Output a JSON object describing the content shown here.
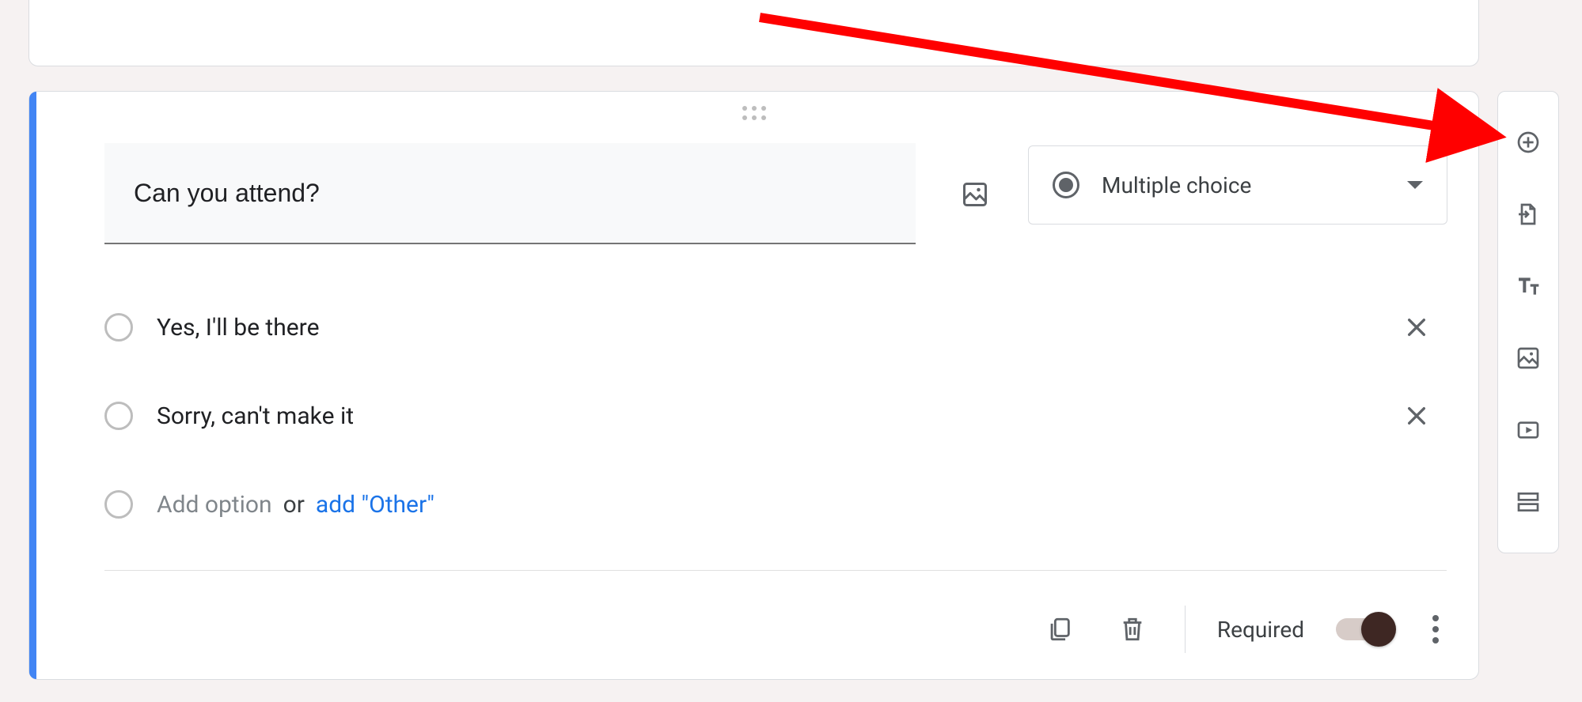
{
  "question": {
    "title": "Can you attend?",
    "type_label": "Multiple choice",
    "options": [
      "Yes,  I'll be there",
      "Sorry, can't make it"
    ],
    "add_option_placeholder": "Add option",
    "add_or_text": "or",
    "add_other_label": "add \"Other\""
  },
  "footer": {
    "required_label": "Required",
    "required_value": true
  },
  "sidebar": {
    "items": [
      "add-question",
      "import-questions",
      "add-title-description",
      "add-image",
      "add-video",
      "add-section"
    ]
  }
}
